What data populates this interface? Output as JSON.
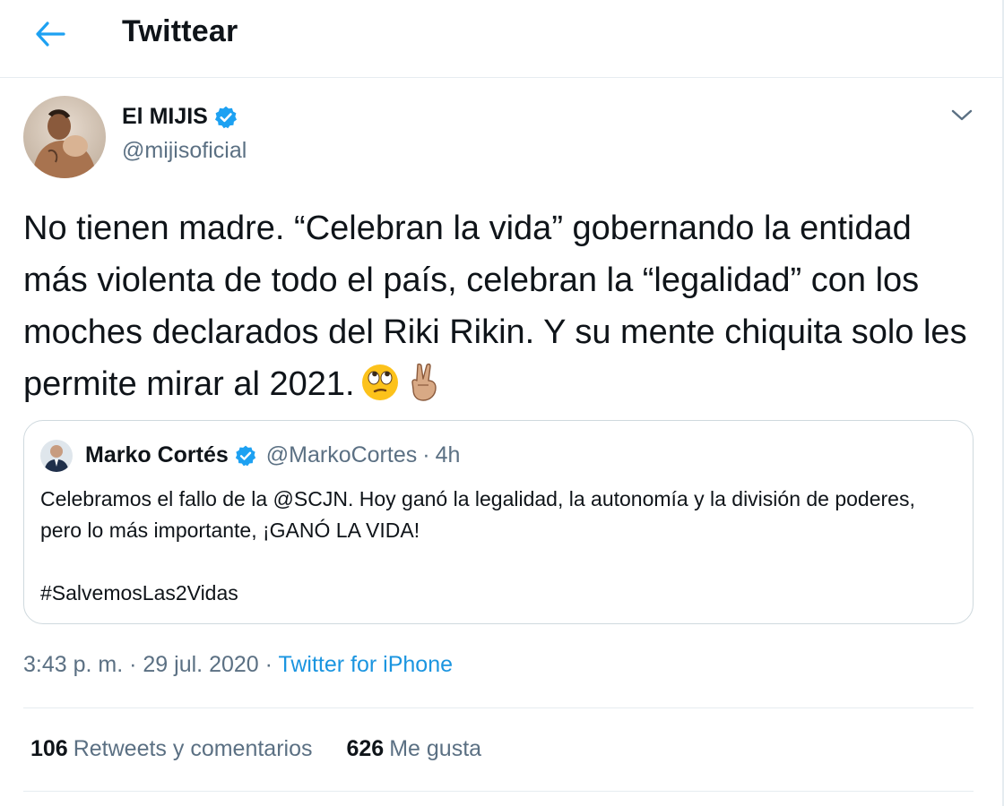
{
  "header": {
    "title": "Twittear",
    "back_icon": "arrow-left-icon"
  },
  "tweet": {
    "author_name": "El MIJIS",
    "author_handle": "@mijisoficial",
    "text": "No tienen madre. “Celebran la vida” gobernando la entidad más violenta de todo el país, celebran la “legalidad” con los moches declarados del Riki Rikin. Y su mente chiquita solo les permite mirar al 2021.",
    "emojis": [
      "face-with-rolling-eyes-emoji",
      "victory-hand-emoji"
    ]
  },
  "quote": {
    "author_name": "Marko Cortés",
    "author_handle": "@MarkoCortes",
    "separator": "·",
    "time": "4h",
    "text_prefix": "Celebramos el fallo de la ",
    "mention": "@SCJN",
    "text_suffix": ". Hoy ganó la legalidad, la autonomía y la división de poderes, pero lo más importante, ¡GANÓ LA VIDA!",
    "hashtag": "#SalvemosLas2Vidas"
  },
  "meta": {
    "time": "3:43 p. m.",
    "separator1": "·",
    "date": "29 jul. 2020",
    "separator2": "·",
    "source": "Twitter for iPhone"
  },
  "stats": {
    "retweets_count": "106",
    "retweets_label": "Retweets y comentarios",
    "likes_count": "626",
    "likes_label": "Me gusta"
  },
  "colors": {
    "accent": "#1da1f2",
    "link": "#1b95e0",
    "secondary_text": "#5b7083",
    "border": "#e6ecf0"
  }
}
